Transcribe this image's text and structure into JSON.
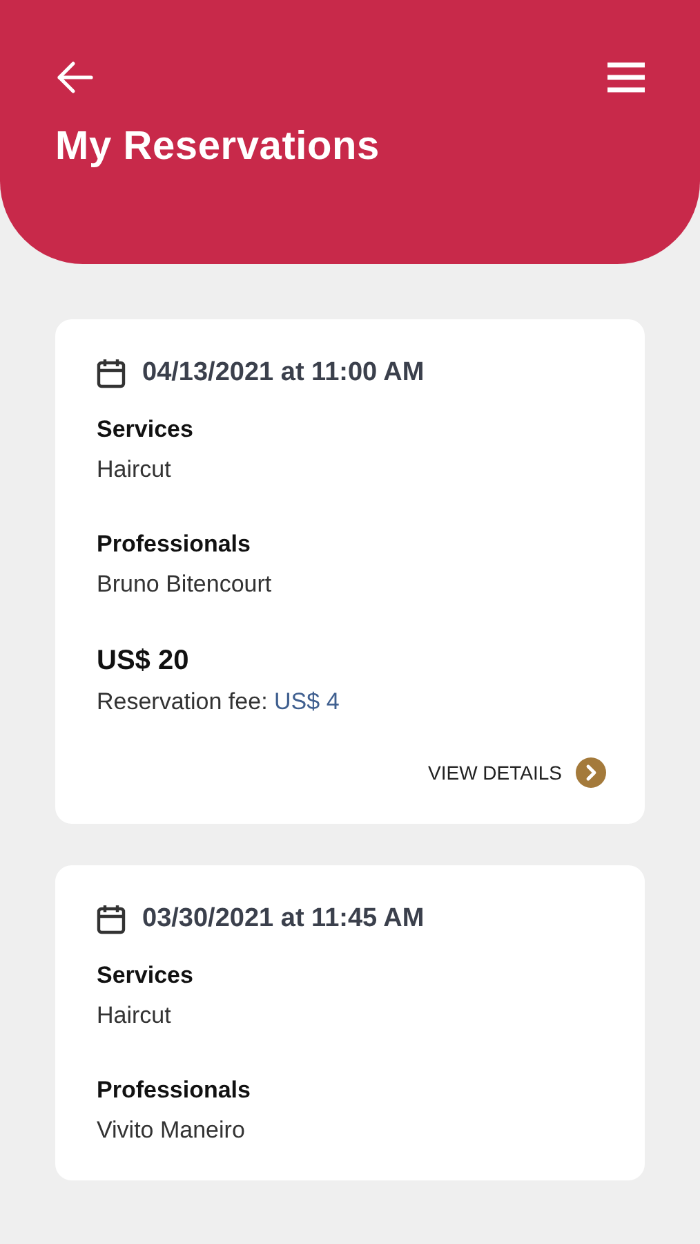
{
  "header": {
    "title": "My Reservations"
  },
  "reservations": [
    {
      "date": "04/13/2021 at 11:00 AM",
      "services_label": "Services",
      "service": "Haircut",
      "professionals_label": "Professionals",
      "professional": "Bruno Bitencourt",
      "price": "US$ 20",
      "fee_label": "Reservation fee:",
      "fee": "US$ 4",
      "details": "VIEW DETAILS"
    },
    {
      "date": "03/30/2021 at 11:45 AM",
      "services_label": "Services",
      "service": "Haircut",
      "professionals_label": "Professionals",
      "professional": "Vivito Maneiro"
    }
  ]
}
